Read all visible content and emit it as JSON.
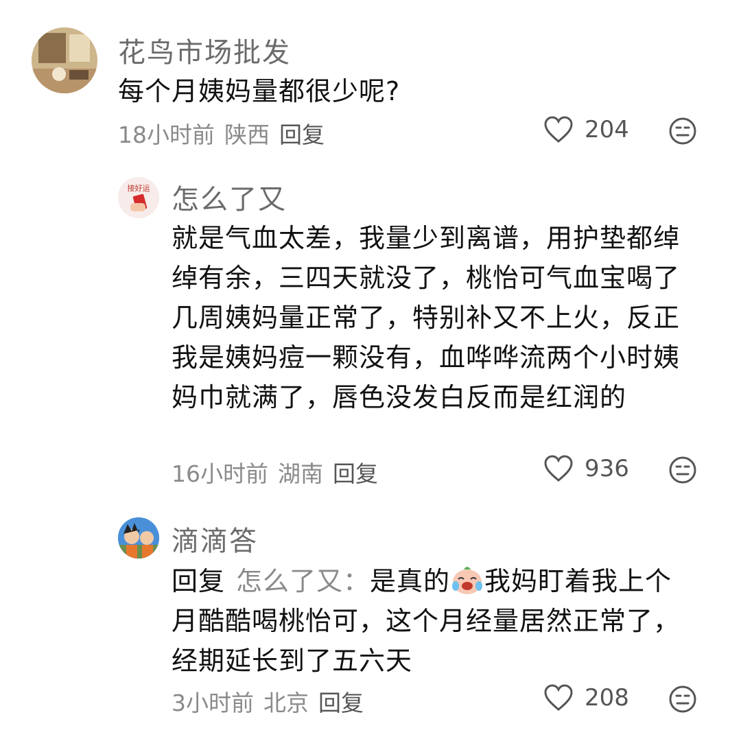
{
  "comments": [
    {
      "username": "花鸟市场批发",
      "content": "每个月姨妈量都很少呢?",
      "time": "18小时前",
      "location": "陕西",
      "reply_label": "回复",
      "likes": "204"
    },
    {
      "username": "怎么了又",
      "avatar_text": "接好运",
      "content": "就是气血太差，我量少到离谱，用护垫都绰绰有余，三四天就没了，桃怡可气血宝喝了几周姨妈量正常了，特别补又不上火，反正我是姨妈痘一颗没有，血哗哗流两个小时姨妈巾就满了，唇色没发白反而是红润的",
      "time": "16小时前",
      "location": "湖南",
      "reply_label": "回复",
      "likes": "936"
    },
    {
      "username": "滴滴答",
      "reply_prefix": "回复",
      "reply_target": "怎么了又：",
      "content_before_emoji": "是真的",
      "emoji_name": "crying-laughing-emoji",
      "content_after_emoji": "我妈盯着我上个月酷酷喝桃怡可，这个月经量居然正常了，经期延长到了五六天",
      "time": "3小时前",
      "location": "北京",
      "reply_label": "回复",
      "likes": "208"
    }
  ]
}
